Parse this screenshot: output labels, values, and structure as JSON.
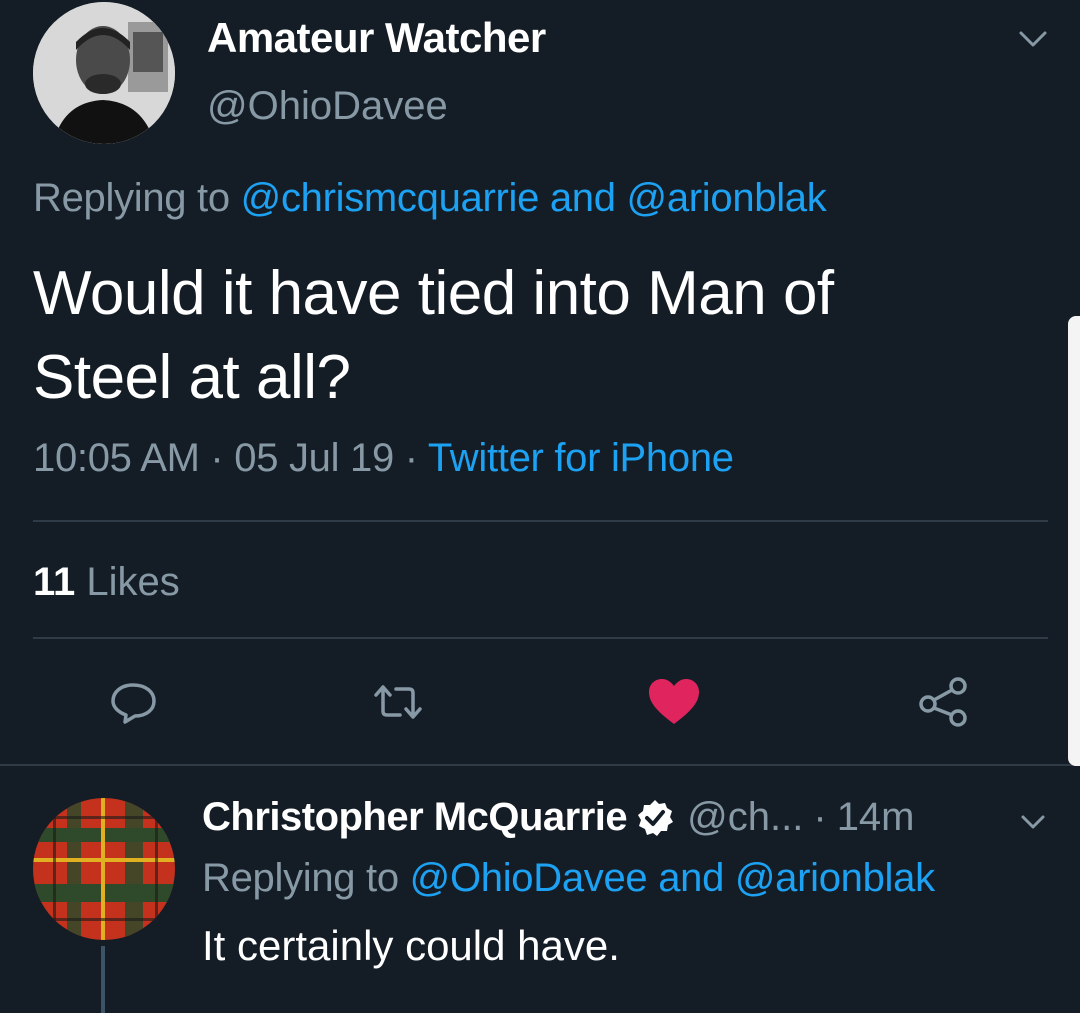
{
  "tweet": {
    "author_name": "Amateur Watcher",
    "author_handle": "@OhioDavee",
    "replying_prefix": "Replying to ",
    "replying_user_1": "@chrismcquarrie",
    "replying_and": " and ",
    "replying_user_2": "@arionblak",
    "text_line_1": "Would it have tied into Man of",
    "text_line_2": "Steel at all?",
    "time": "10:05 AM",
    "sep": " · ",
    "date": "05 Jul 19",
    "client": "Twitter for iPhone",
    "likes_count": "11",
    "likes_label": " Likes"
  },
  "actions": {
    "reply_icon": "reply-icon",
    "retweet_icon": "retweet-icon",
    "like_icon": "heart-icon",
    "share_icon": "share-icon",
    "like_color": "#e0245e"
  },
  "reply": {
    "author_name": "Christopher McQuarrie",
    "author_handle": "@ch...",
    "sep": "·",
    "time": "14m",
    "replying_prefix": "Replying to ",
    "replying_user_1": "@OhioDavee",
    "replying_and": " and ",
    "replying_user_2": "@arionblak",
    "text": "It certainly could have."
  },
  "colors": {
    "background": "#141d26",
    "link": "#1da1f2",
    "secondary_text": "#8899a6"
  }
}
